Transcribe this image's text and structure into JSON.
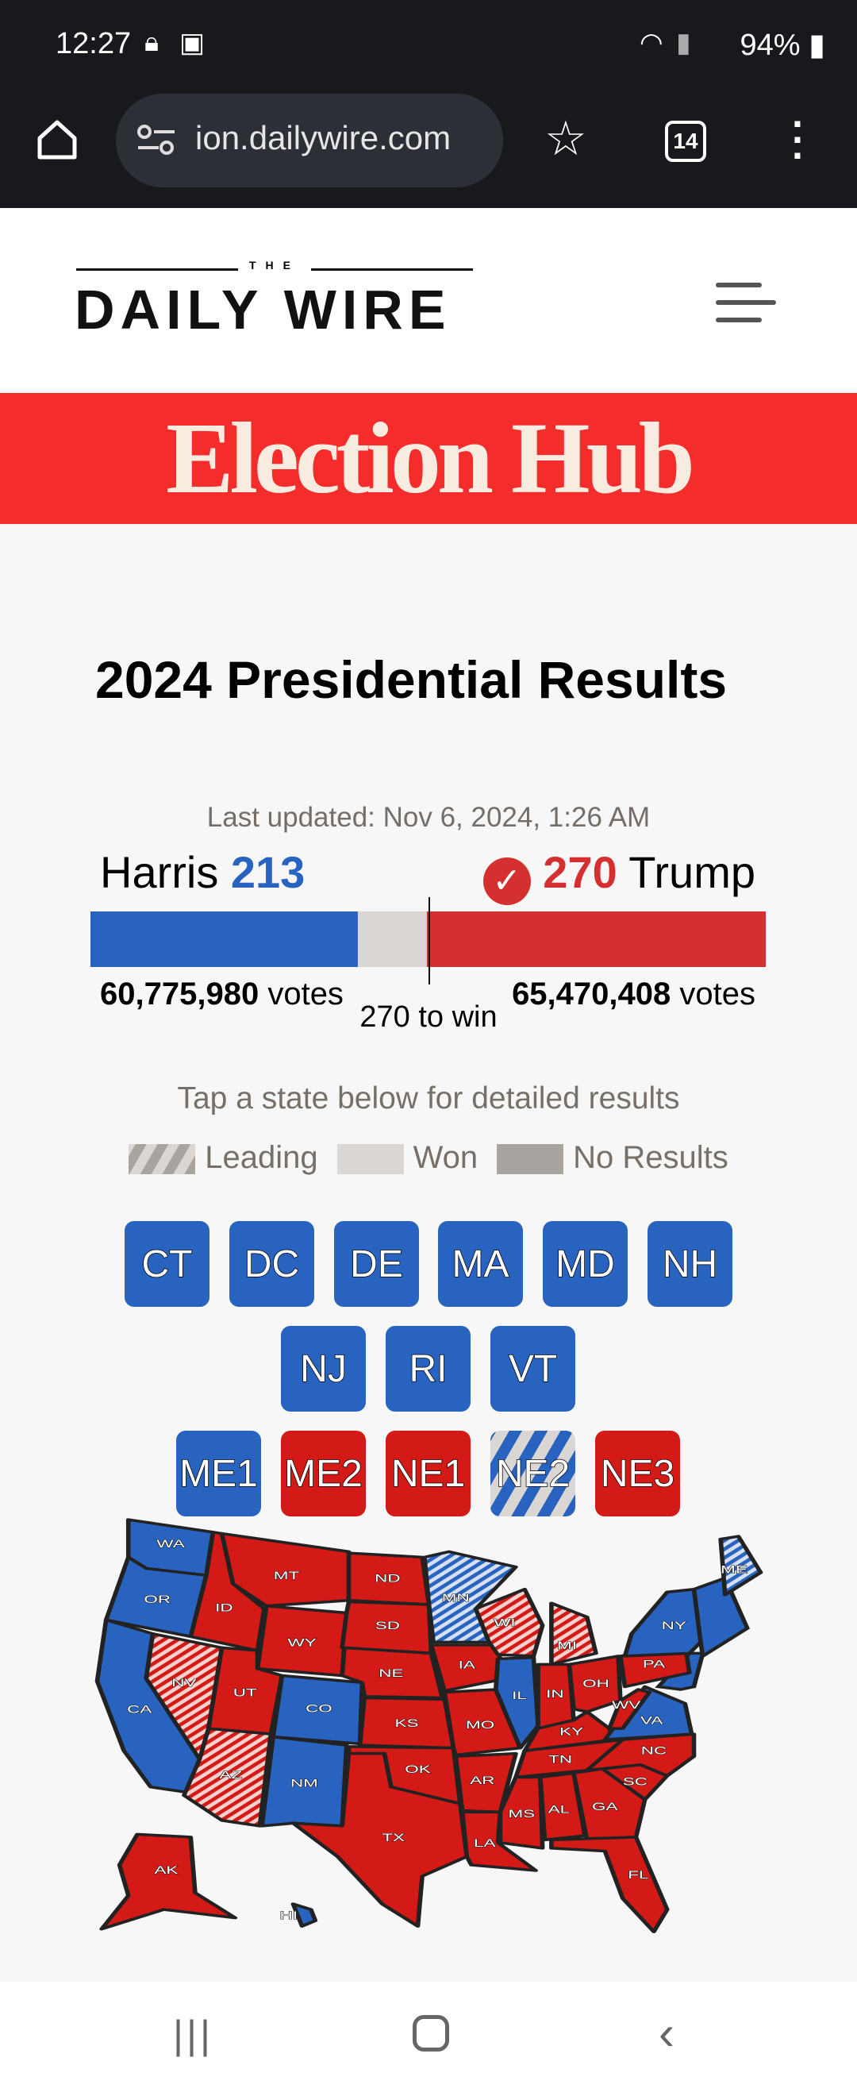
{
  "status_bar": {
    "time": "12:27",
    "battery": "94%"
  },
  "browser": {
    "url": "ion.dailywire.com",
    "tab_count": "14"
  },
  "site": {
    "logo_small": "THE",
    "logo": "DAILY WIRE",
    "banner": "Election Hub"
  },
  "results": {
    "title": "2024 Presidential Results",
    "last_updated": "Last updated: Nov 6, 2024, 1:26 AM",
    "harris": {
      "name": "Harris",
      "ev": "213",
      "votes": "60,775,980",
      "votes_label": "votes"
    },
    "trump": {
      "name": "Trump",
      "ev": "270",
      "votes": "65,470,408",
      "votes_label": "votes",
      "winner": true
    },
    "threshold": "270 to win",
    "bar": {
      "harris_ev": 213,
      "trump_ev": 270,
      "total_ev": 538,
      "threshold_ev": 270
    },
    "tap_hint": "Tap a state below for detailed results",
    "legend": [
      "Leading",
      "Won",
      "No Results"
    ]
  },
  "colors": {
    "dem": "#2763bf",
    "rep": "#d41a16",
    "won": "#d9d6d3",
    "no_results": "#a8a4a0",
    "banner": "#f42c2c"
  },
  "small_states": [
    [
      {
        "code": "CT",
        "s": "D"
      },
      {
        "code": "DC",
        "s": "D"
      },
      {
        "code": "DE",
        "s": "D"
      },
      {
        "code": "MA",
        "s": "D"
      },
      {
        "code": "MD",
        "s": "D"
      },
      {
        "code": "NH",
        "s": "D"
      }
    ],
    [
      {
        "code": "NJ",
        "s": "D"
      },
      {
        "code": "RI",
        "s": "D"
      },
      {
        "code": "VT",
        "s": "D"
      }
    ],
    [
      {
        "code": "ME1",
        "s": "D"
      },
      {
        "code": "ME2",
        "s": "R"
      },
      {
        "code": "NE1",
        "s": "R"
      },
      {
        "code": "NE2",
        "s": "LD"
      },
      {
        "code": "NE3",
        "s": "R"
      }
    ]
  ],
  "map_states": [
    {
      "code": "WA",
      "s": "D"
    },
    {
      "code": "OR",
      "s": "D"
    },
    {
      "code": "CA",
      "s": "D"
    },
    {
      "code": "NV",
      "s": "LR"
    },
    {
      "code": "ID",
      "s": "R"
    },
    {
      "code": "MT",
      "s": "R"
    },
    {
      "code": "WY",
      "s": "R"
    },
    {
      "code": "UT",
      "s": "R"
    },
    {
      "code": "AZ",
      "s": "LR"
    },
    {
      "code": "CO",
      "s": "D"
    },
    {
      "code": "NM",
      "s": "D"
    },
    {
      "code": "ND",
      "s": "R"
    },
    {
      "code": "SD",
      "s": "R"
    },
    {
      "code": "NE",
      "s": "R"
    },
    {
      "code": "KS",
      "s": "R"
    },
    {
      "code": "OK",
      "s": "R"
    },
    {
      "code": "TX",
      "s": "R"
    },
    {
      "code": "MN",
      "s": "LD"
    },
    {
      "code": "IA",
      "s": "R"
    },
    {
      "code": "MO",
      "s": "R"
    },
    {
      "code": "AR",
      "s": "R"
    },
    {
      "code": "LA",
      "s": "R"
    },
    {
      "code": "WI",
      "s": "LR"
    },
    {
      "code": "IL",
      "s": "D"
    },
    {
      "code": "MI",
      "s": "LR"
    },
    {
      "code": "IN",
      "s": "R"
    },
    {
      "code": "OH",
      "s": "R"
    },
    {
      "code": "KY",
      "s": "R"
    },
    {
      "code": "TN",
      "s": "R"
    },
    {
      "code": "MS",
      "s": "R"
    },
    {
      "code": "AL",
      "s": "R"
    },
    {
      "code": "GA",
      "s": "R"
    },
    {
      "code": "FL",
      "s": "R"
    },
    {
      "code": "SC",
      "s": "R"
    },
    {
      "code": "NC",
      "s": "R"
    },
    {
      "code": "VA",
      "s": "D"
    },
    {
      "code": "WV",
      "s": "R"
    },
    {
      "code": "PA",
      "s": "R"
    },
    {
      "code": "NY",
      "s": "D"
    },
    {
      "code": "ME",
      "s": "LD"
    },
    {
      "code": "AK",
      "s": "R"
    },
    {
      "code": "HI",
      "s": "D"
    }
  ]
}
